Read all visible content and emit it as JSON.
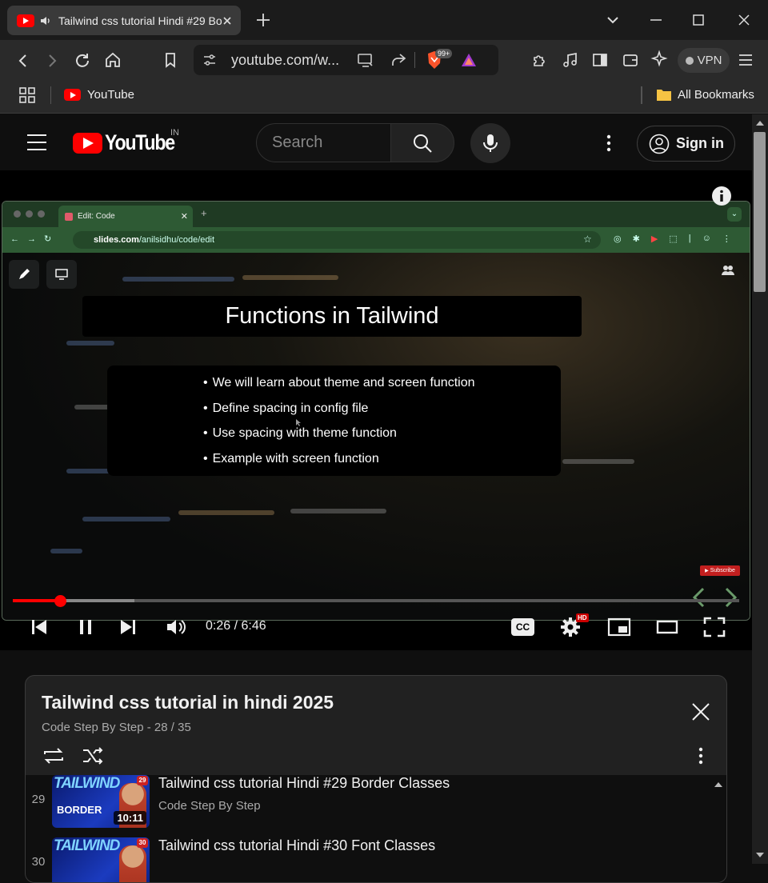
{
  "browser": {
    "tab_title": "Tailwind css tutorial Hindi #29 Border Classes",
    "url": "youtube.com/w...",
    "shields_badge": "99+",
    "vpn_label": "VPN",
    "bookmarks": {
      "youtube": "YouTube",
      "all": "All Bookmarks"
    }
  },
  "youtube": {
    "logo_text": "YouTube",
    "region": "IN",
    "search_placeholder": "Search",
    "sign_in": "Sign in"
  },
  "video": {
    "inner_tab_title": "Edit: Code",
    "inner_url_host": "slides.com",
    "inner_url_path": "/anilsidhu/code/edit",
    "slide_title": "Functions in Tailwind",
    "slide_points": [
      "We will learn about theme and screen function",
      "Define spacing in config file",
      "Use spacing with theme function",
      "Example with screen function"
    ],
    "subscribe_badge": "Subscribe",
    "hd_badge": "HD",
    "cc_label": "CC",
    "time": "0:26 / 6:46",
    "progress": 0.065
  },
  "playlist": {
    "title": "Tailwind css tutorial in hindi 2025",
    "subtitle": "Code Step By Step - 28 / 35",
    "items": [
      {
        "num": "29",
        "title": "Tailwind css tutorial Hindi #29 Border Classes",
        "channel": "Code Step By Step",
        "duration": "10:11",
        "thumb_word": "BORDER",
        "thumb_brand": "TAILWIND",
        "ep": "29"
      },
      {
        "num": "30",
        "title": "Tailwind css tutorial Hindi #30 Font Classes",
        "channel": "",
        "duration": "",
        "thumb_word": "",
        "thumb_brand": "TAILWIND",
        "ep": "30"
      }
    ]
  }
}
